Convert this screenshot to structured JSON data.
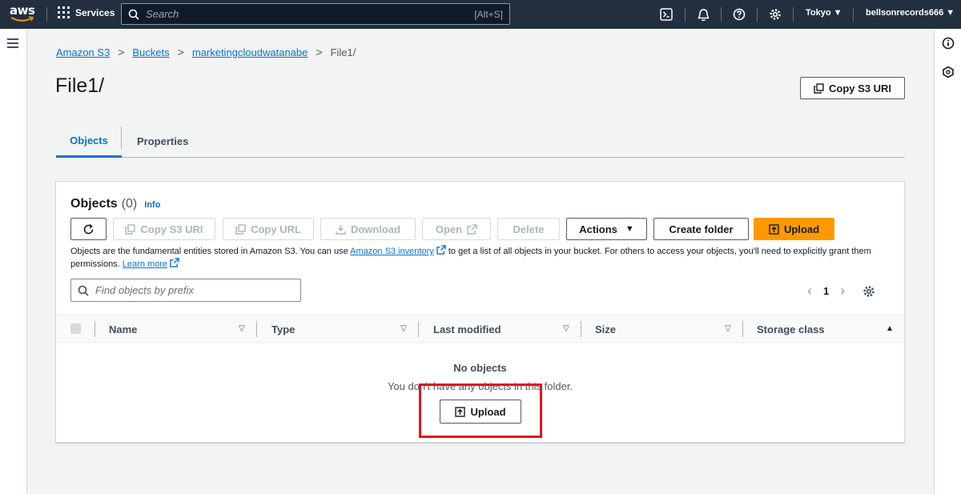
{
  "topnav": {
    "logo_text": "aws",
    "services_label": "Services",
    "search_placeholder": "Search",
    "search_shortcut": "[Alt+S]",
    "region": "Tokyo",
    "account": "bellsonrecords666"
  },
  "breadcrumb": {
    "items": [
      "Amazon S3",
      "Buckets",
      "marketingcloudwatanabe"
    ],
    "current": "File1/"
  },
  "page": {
    "title": "File1/",
    "copy_uri_label": "Copy S3 URI"
  },
  "tabs": {
    "objects": "Objects",
    "properties": "Properties"
  },
  "objects_panel": {
    "heading": "Objects",
    "count": "(0)",
    "info": "Info",
    "toolbar": {
      "copy_s3_uri": "Copy S3 URI",
      "copy_url": "Copy URL",
      "download": "Download",
      "open": "Open",
      "delete": "Delete",
      "actions": "Actions",
      "create_folder": "Create folder",
      "upload": "Upload"
    },
    "description": {
      "part1": "Objects are the fundamental entities stored in Amazon S3. You can use ",
      "inventory_link": "Amazon S3 inventory",
      "part2": " to get a list of all objects in your bucket. For others to access your objects, you'll need to explicitly grant them permissions. ",
      "learn_more": "Learn more"
    },
    "find_placeholder": "Find objects by prefix",
    "page_number": "1",
    "columns": [
      "Name",
      "Type",
      "Last modified",
      "Size",
      "Storage class"
    ],
    "empty_title": "No objects",
    "empty_subtitle": "You don't have any objects in this folder.",
    "empty_upload": "Upload"
  },
  "colors": {
    "nav_bg": "#232f3e",
    "link": "#0972d3",
    "primary": "#ff9900",
    "highlight": "#e0141e"
  }
}
